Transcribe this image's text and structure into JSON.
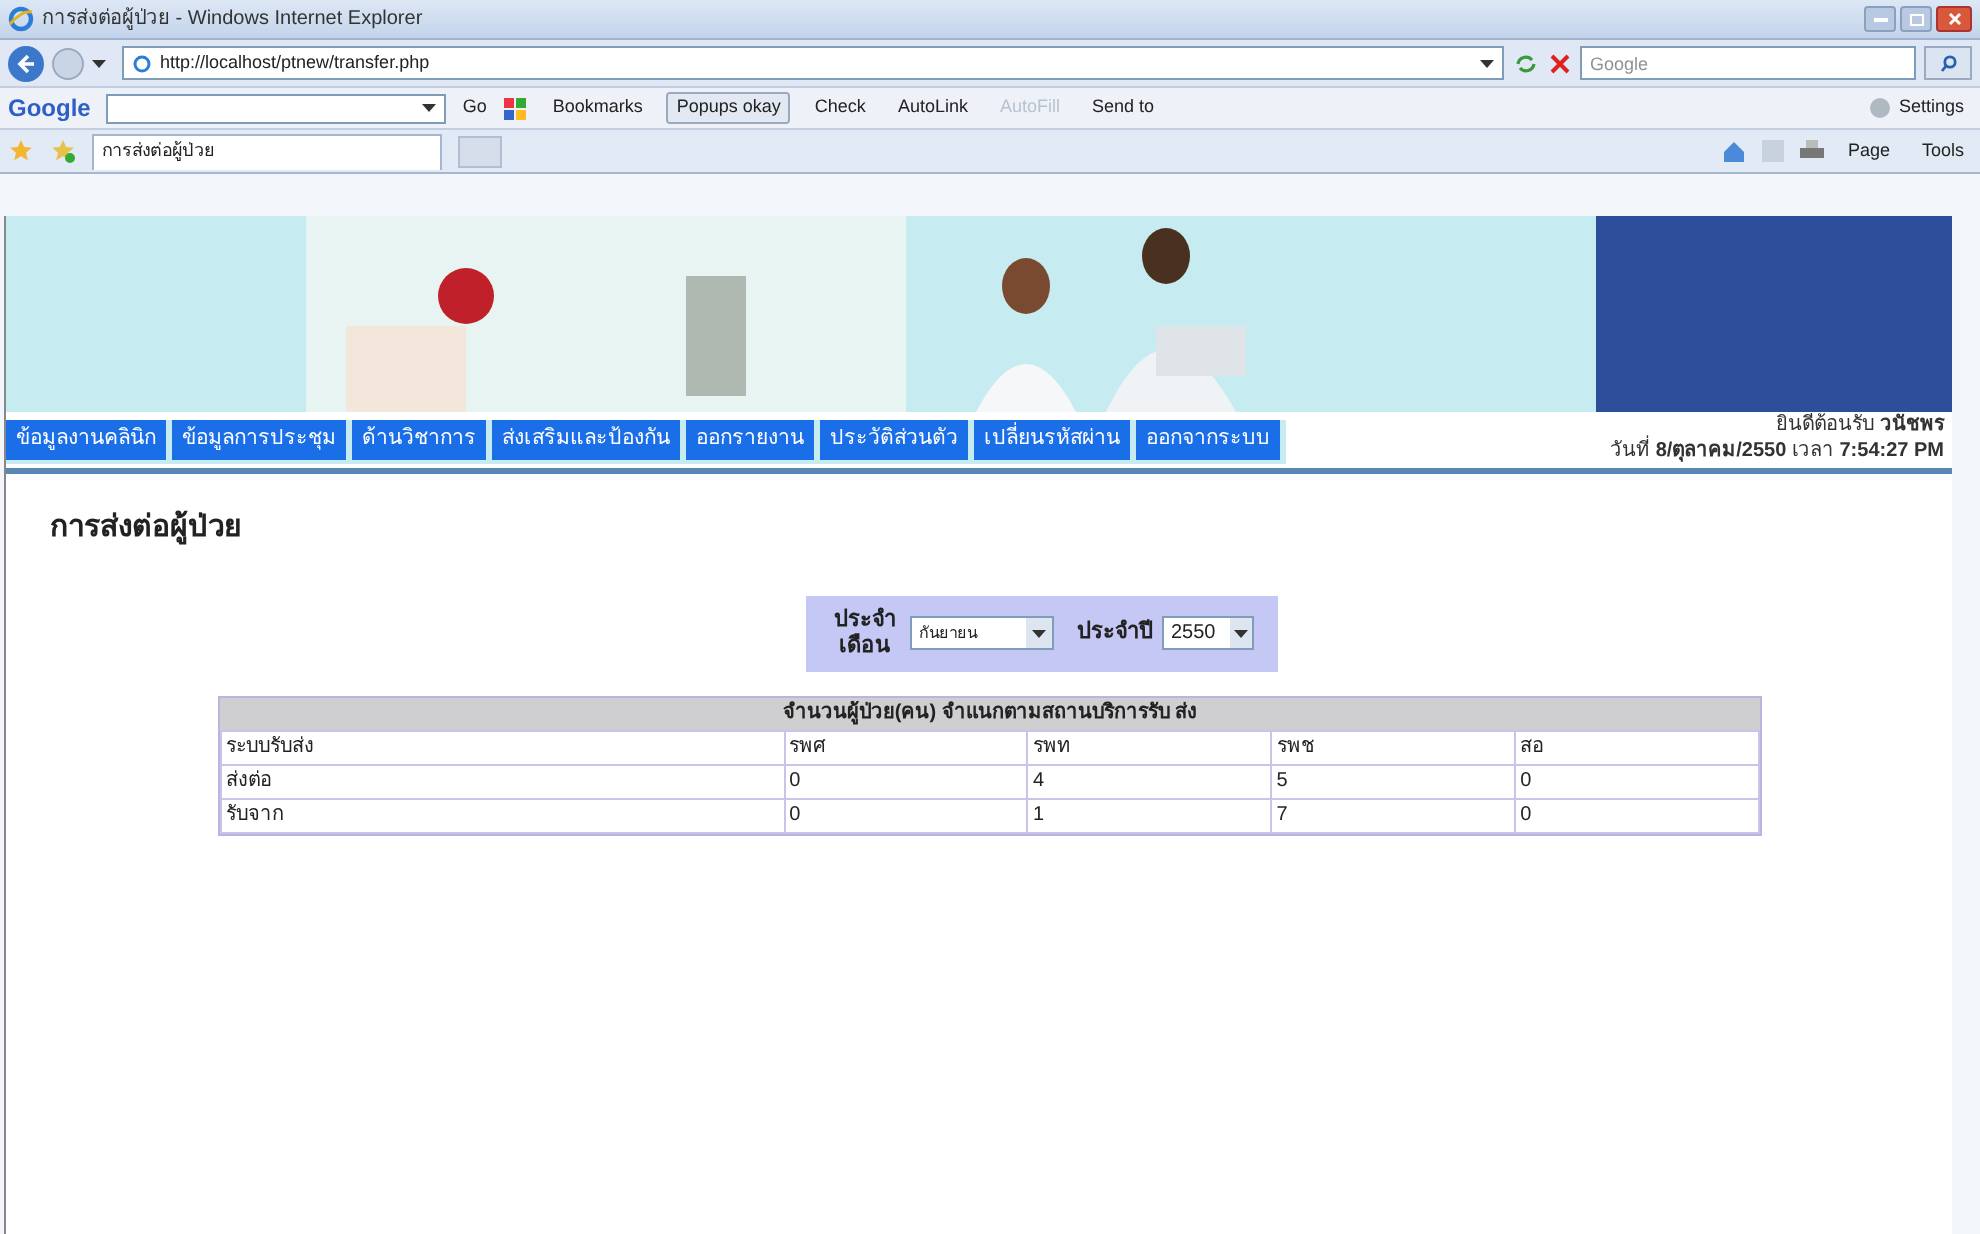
{
  "window": {
    "title": "การส่งต่อผู้ป่วย - Windows Internet Explorer"
  },
  "address_bar": {
    "url": "http://localhost/ptnew/transfer.php",
    "search_placeholder": "Google"
  },
  "google_toolbar": {
    "logo": "Google",
    "go": "Go",
    "items": [
      {
        "label": "Bookmarks",
        "disabled": false
      },
      {
        "label": "Popups okay",
        "disabled": false
      },
      {
        "label": "Check",
        "disabled": false
      },
      {
        "label": "AutoLink",
        "disabled": false
      },
      {
        "label": "AutoFill",
        "disabled": true
      },
      {
        "label": "Send to",
        "disabled": false
      }
    ],
    "settings": "Settings"
  },
  "tab": {
    "title": "การส่งต่อผู้ป่วย"
  },
  "command_bar": [
    "Page",
    "Tools"
  ],
  "menu": [
    {
      "label": "ข้อมูลงานคลินิก"
    },
    {
      "label": "ข้อมูลการประชุม"
    },
    {
      "label": "ด้านวิชาการ"
    },
    {
      "label": "ส่งเสริมและป้องกัน"
    },
    {
      "label": "ออกรายงาน"
    },
    {
      "label": "ประวัติส่วนตัว"
    },
    {
      "label": "เปลี่ยนรหัสผ่าน"
    },
    {
      "label": "ออกจากระบบ"
    }
  ],
  "welcome": {
    "greeting": "ยินดีต้อนรับ",
    "user": "วนัชพร",
    "date_label": "วันที่",
    "date": "8/ตุลาคม/2550",
    "time_label": "เวลา",
    "time": "7:54:27 PM"
  },
  "page_title": "การส่งต่อผู้ป่วย",
  "filter": {
    "month_label": "ประจำเดือน",
    "month": "กันยายน",
    "year_label": "ประจำปี",
    "year": "2550"
  },
  "table": {
    "caption": "จำนวนผู้ป่วย(คน) จำแนกตามสถานบริการรับ ส่ง",
    "columns": [
      "ระบบรับส่ง",
      "รพศ",
      "รพท",
      "รพช",
      "สอ"
    ],
    "rows": [
      [
        "ส่งต่อ",
        "0",
        "4",
        "5",
        "0"
      ],
      [
        "รับจาก",
        "0",
        "1",
        "7",
        "0"
      ]
    ]
  }
}
